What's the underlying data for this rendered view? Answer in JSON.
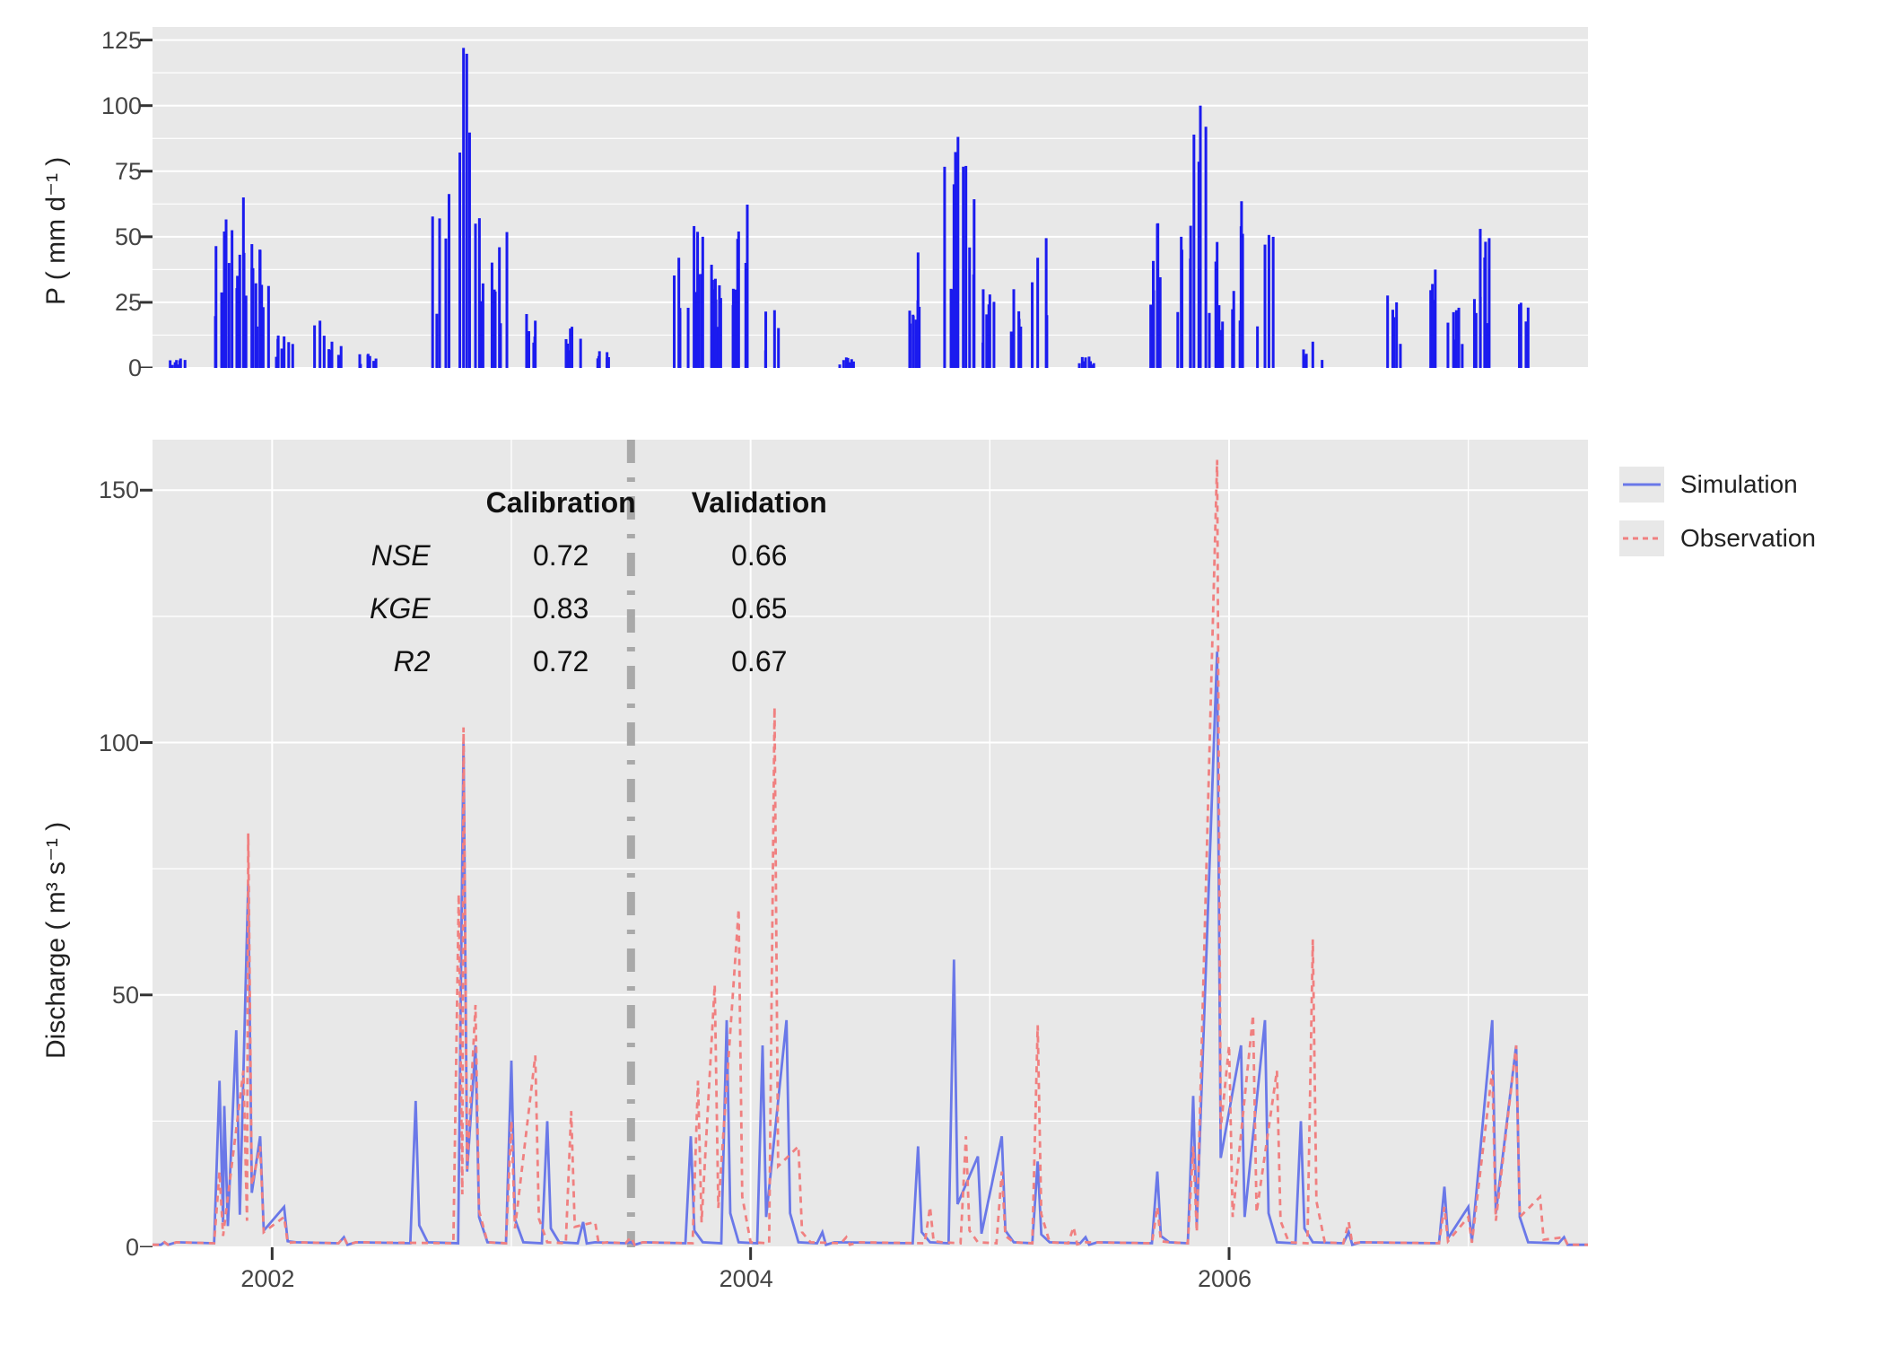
{
  "top_panel": {
    "ylabel": "P ( mm d⁻¹ )",
    "y_ticks": [
      0,
      25,
      50,
      75,
      100,
      125
    ]
  },
  "bottom_panel": {
    "ylabel": "Discharge ( m³ s⁻¹ )",
    "y_ticks": [
      0,
      50,
      100,
      150
    ],
    "x_ticks": [
      "2002",
      "2004",
      "2006"
    ]
  },
  "legend": {
    "items": [
      {
        "label": "Simulation",
        "color": "#6a78e8",
        "dash": "none"
      },
      {
        "label": "Observation",
        "color": "#f08080",
        "dash": "dashed"
      }
    ]
  },
  "stats": {
    "col_headers": [
      "Calibration",
      "Validation"
    ],
    "rows": [
      {
        "metric": "NSE",
        "calibration": "0.72",
        "validation": "0.66"
      },
      {
        "metric": "KGE",
        "calibration": "0.83",
        "validation": "0.65"
      },
      {
        "metric": "R2",
        "calibration": "0.72",
        "validation": "0.67"
      }
    ]
  },
  "chart_data": [
    {
      "type": "bar",
      "title": "",
      "xlabel": "",
      "ylabel": "P ( mm d⁻¹ )",
      "x_range_years": [
        2001.5,
        2007.5
      ],
      "ylim": [
        0,
        130
      ],
      "note": "daily precipitation; values visually estimated",
      "series": [
        {
          "name": "Precipitation",
          "color": "#1b1bef",
          "sample_points": [
            {
              "x": 2001.6,
              "value": 3
            },
            {
              "x": 2001.8,
              "value": 52
            },
            {
              "x": 2001.82,
              "value": 40
            },
            {
              "x": 2001.88,
              "value": 65
            },
            {
              "x": 2001.92,
              "value": 38
            },
            {
              "x": 2001.95,
              "value": 45
            },
            {
              "x": 2002.05,
              "value": 12
            },
            {
              "x": 2002.2,
              "value": 18
            },
            {
              "x": 2002.25,
              "value": 10
            },
            {
              "x": 2002.4,
              "value": 5
            },
            {
              "x": 2002.7,
              "value": 57
            },
            {
              "x": 2002.8,
              "value": 122
            },
            {
              "x": 2002.85,
              "value": 55
            },
            {
              "x": 2002.95,
              "value": 46
            },
            {
              "x": 2003.1,
              "value": 18
            },
            {
              "x": 2003.25,
              "value": 15
            },
            {
              "x": 2003.4,
              "value": 6
            },
            {
              "x": 2003.7,
              "value": 42
            },
            {
              "x": 2003.8,
              "value": 50
            },
            {
              "x": 2003.85,
              "value": 30
            },
            {
              "x": 2003.95,
              "value": 52
            },
            {
              "x": 2004.1,
              "value": 22
            },
            {
              "x": 2004.4,
              "value": 4
            },
            {
              "x": 2004.7,
              "value": 44
            },
            {
              "x": 2004.85,
              "value": 70
            },
            {
              "x": 2004.9,
              "value": 77
            },
            {
              "x": 2005.0,
              "value": 28
            },
            {
              "x": 2005.1,
              "value": 30
            },
            {
              "x": 2005.2,
              "value": 42
            },
            {
              "x": 2005.4,
              "value": 4
            },
            {
              "x": 2005.7,
              "value": 55
            },
            {
              "x": 2005.8,
              "value": 50
            },
            {
              "x": 2005.88,
              "value": 100
            },
            {
              "x": 2005.95,
              "value": 48
            },
            {
              "x": 2006.05,
              "value": 54
            },
            {
              "x": 2006.15,
              "value": 47
            },
            {
              "x": 2006.35,
              "value": 10
            },
            {
              "x": 2006.7,
              "value": 25
            },
            {
              "x": 2006.85,
              "value": 32
            },
            {
              "x": 2006.95,
              "value": 22
            },
            {
              "x": 2007.05,
              "value": 53
            },
            {
              "x": 2007.25,
              "value": 23
            }
          ]
        }
      ]
    },
    {
      "type": "line",
      "title": "",
      "xlabel": "",
      "ylabel": "Discharge ( m³ s⁻¹ )",
      "x_range_years": [
        2001.5,
        2007.5
      ],
      "ylim": [
        0,
        160
      ],
      "divider_x": 2003.5,
      "annotations": {
        "col_headers": [
          "Calibration",
          "Validation"
        ],
        "metrics": {
          "NSE": {
            "Calibration": 0.72,
            "Validation": 0.66
          },
          "KGE": {
            "Calibration": 0.83,
            "Validation": 0.65
          },
          "R2": {
            "Calibration": 0.72,
            "Validation": 0.67
          }
        }
      },
      "legend": [
        "Simulation",
        "Observation"
      ],
      "series": [
        {
          "name": "Simulation",
          "color": "#6a78e8",
          "dash": "solid",
          "sample_points": [
            {
              "x": 2001.55,
              "y": 1
            },
            {
              "x": 2001.78,
              "y": 33
            },
            {
              "x": 2001.8,
              "y": 28
            },
            {
              "x": 2001.85,
              "y": 43
            },
            {
              "x": 2001.9,
              "y": 72
            },
            {
              "x": 2001.95,
              "y": 22
            },
            {
              "x": 2002.05,
              "y": 8
            },
            {
              "x": 2002.3,
              "y": 2
            },
            {
              "x": 2002.6,
              "y": 29
            },
            {
              "x": 2002.8,
              "y": 100
            },
            {
              "x": 2002.85,
              "y": 40
            },
            {
              "x": 2003.0,
              "y": 37
            },
            {
              "x": 2003.15,
              "y": 25
            },
            {
              "x": 2003.3,
              "y": 5
            },
            {
              "x": 2003.5,
              "y": 1
            },
            {
              "x": 2003.75,
              "y": 22
            },
            {
              "x": 2003.9,
              "y": 45
            },
            {
              "x": 2004.05,
              "y": 40
            },
            {
              "x": 2004.15,
              "y": 45
            },
            {
              "x": 2004.3,
              "y": 3
            },
            {
              "x": 2004.7,
              "y": 20
            },
            {
              "x": 2004.85,
              "y": 57
            },
            {
              "x": 2004.95,
              "y": 18
            },
            {
              "x": 2005.05,
              "y": 22
            },
            {
              "x": 2005.2,
              "y": 17
            },
            {
              "x": 2005.4,
              "y": 2
            },
            {
              "x": 2005.7,
              "y": 15
            },
            {
              "x": 2005.85,
              "y": 30
            },
            {
              "x": 2005.95,
              "y": 118
            },
            {
              "x": 2006.05,
              "y": 40
            },
            {
              "x": 2006.15,
              "y": 45
            },
            {
              "x": 2006.3,
              "y": 25
            },
            {
              "x": 2006.5,
              "y": 3
            },
            {
              "x": 2006.9,
              "y": 12
            },
            {
              "x": 2007.0,
              "y": 8
            },
            {
              "x": 2007.1,
              "y": 45
            },
            {
              "x": 2007.2,
              "y": 40
            },
            {
              "x": 2007.4,
              "y": 2
            }
          ]
        },
        {
          "name": "Observation",
          "color": "#f08080",
          "dash": "dashed",
          "sample_points": [
            {
              "x": 2001.55,
              "y": 1
            },
            {
              "x": 2001.78,
              "y": 15
            },
            {
              "x": 2001.88,
              "y": 35
            },
            {
              "x": 2001.9,
              "y": 82
            },
            {
              "x": 2001.95,
              "y": 20
            },
            {
              "x": 2002.05,
              "y": 6
            },
            {
              "x": 2002.3,
              "y": 2
            },
            {
              "x": 2002.78,
              "y": 70
            },
            {
              "x": 2002.8,
              "y": 103
            },
            {
              "x": 2002.85,
              "y": 48
            },
            {
              "x": 2003.0,
              "y": 25
            },
            {
              "x": 2003.1,
              "y": 38
            },
            {
              "x": 2003.25,
              "y": 27
            },
            {
              "x": 2003.35,
              "y": 5
            },
            {
              "x": 2003.5,
              "y": 2
            },
            {
              "x": 2003.78,
              "y": 33
            },
            {
              "x": 2003.85,
              "y": 52
            },
            {
              "x": 2003.95,
              "y": 67
            },
            {
              "x": 2004.1,
              "y": 107
            },
            {
              "x": 2004.2,
              "y": 20
            },
            {
              "x": 2004.4,
              "y": 2
            },
            {
              "x": 2004.75,
              "y": 8
            },
            {
              "x": 2004.9,
              "y": 22
            },
            {
              "x": 2005.05,
              "y": 15
            },
            {
              "x": 2005.2,
              "y": 44
            },
            {
              "x": 2005.35,
              "y": 4
            },
            {
              "x": 2005.7,
              "y": 8
            },
            {
              "x": 2005.85,
              "y": 20
            },
            {
              "x": 2005.95,
              "y": 156
            },
            {
              "x": 2006.0,
              "y": 40
            },
            {
              "x": 2006.1,
              "y": 46
            },
            {
              "x": 2006.2,
              "y": 35
            },
            {
              "x": 2006.35,
              "y": 61
            },
            {
              "x": 2006.5,
              "y": 5
            },
            {
              "x": 2006.9,
              "y": 8
            },
            {
              "x": 2007.0,
              "y": 6
            },
            {
              "x": 2007.1,
              "y": 35
            },
            {
              "x": 2007.2,
              "y": 40
            },
            {
              "x": 2007.3,
              "y": 10
            },
            {
              "x": 2007.4,
              "y": 2
            }
          ]
        }
      ]
    }
  ]
}
